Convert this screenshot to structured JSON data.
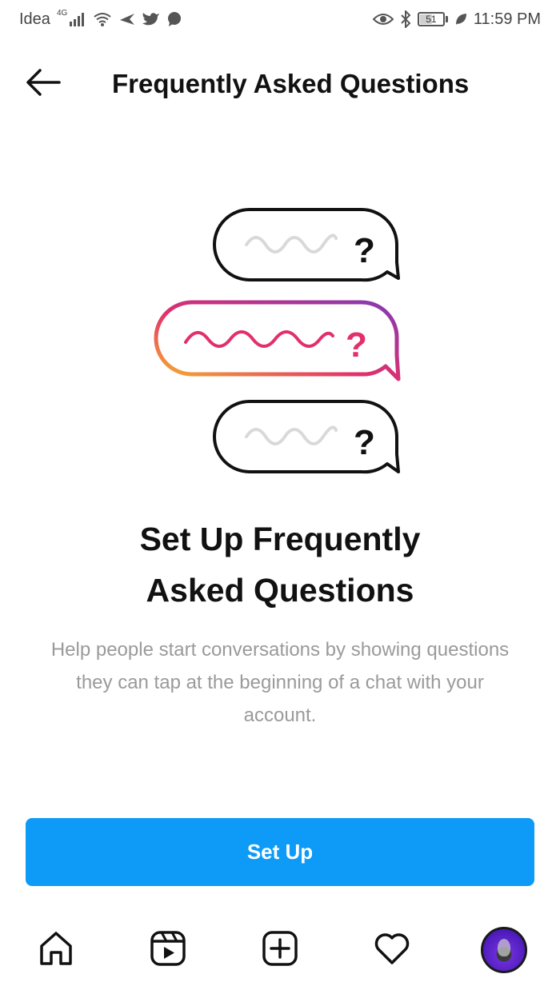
{
  "status_bar": {
    "carrier": "Idea",
    "network": "4G",
    "battery_level": "51",
    "time": "11:59 PM",
    "icons": [
      "signal-icon",
      "wifi-icon",
      "airplane-icon",
      "twitter-icon",
      "chat-icon",
      "eye-icon",
      "bluetooth-icon",
      "battery-icon",
      "leaf-icon"
    ]
  },
  "header": {
    "title": "Frequently Asked Questions",
    "back_icon": "arrow-left-icon"
  },
  "illustration": {
    "bubbles": [
      {
        "mark": "?",
        "style": "gray"
      },
      {
        "mark": "?",
        "style": "gradient"
      },
      {
        "mark": "?",
        "style": "gray"
      }
    ],
    "colors": {
      "outline": "#111111",
      "squiggle_gray": "#d9d9d9",
      "gradient_start": "#f7b42c",
      "gradient_mid": "#e1306c",
      "gradient_end": "#833ab4",
      "squiggle_pink": "#e1306c"
    }
  },
  "main": {
    "heading": "Set Up Frequently\nAsked Questions",
    "description": "Help people start conversations by showing questions they can tap at the beginning of a chat with your account."
  },
  "actions": {
    "setup_label": "Set Up",
    "setup_color": "#0d9bf7"
  },
  "bottom_nav": {
    "items": [
      {
        "icon": "home-icon"
      },
      {
        "icon": "reels-icon"
      },
      {
        "icon": "add-icon"
      },
      {
        "icon": "heart-icon"
      },
      {
        "icon": "profile-avatar"
      }
    ]
  }
}
